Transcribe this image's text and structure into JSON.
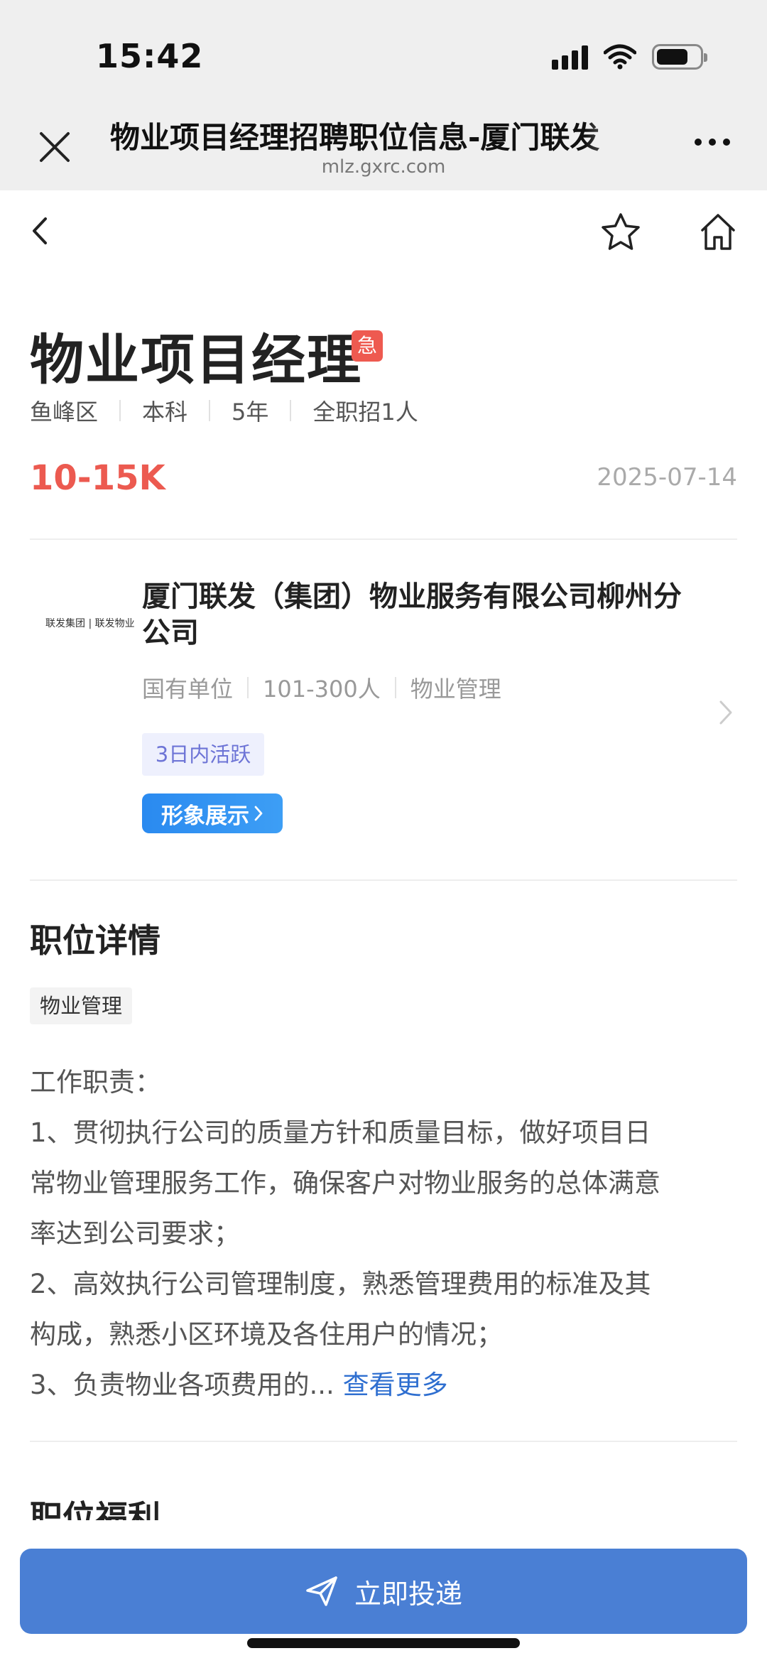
{
  "status_bar": {
    "time": "15:42"
  },
  "browser": {
    "title": "物业项目经理招聘职位信息-厦门联发",
    "url": "mlz.gxrc.com"
  },
  "job": {
    "title": "物业项目经理",
    "urgent": "急",
    "meta": [
      "鱼峰区",
      "本科",
      "5年",
      "全职招1人"
    ],
    "salary": "10-15K",
    "date": "2025-07-14"
  },
  "company": {
    "logo_text": "联发集团 | 联发物业",
    "name": "厦门联发（集团）物业服务有限公司柳州分公司",
    "meta": [
      "国有单位",
      "101-300人",
      "物业管理"
    ],
    "active": "3日内活跃",
    "image_button": "形象展示"
  },
  "details": {
    "section_title": "职位详情",
    "tag": "物业管理",
    "lines": [
      "工作职责：",
      "1、贯彻执行公司的质量方针和质量目标，做好项目日",
      "常物业管理服务工作，确保客户对物业服务的总体满意",
      "率达到公司要求；",
      "2、高效执行公司管理制度，熟悉管理费用的标准及其",
      "构成，熟悉小区环境及各住用户的情况；"
    ],
    "last_line": "3、负责物业各项费用的...",
    "see_more": "查看更多"
  },
  "benefits": {
    "section_title": "职位福利"
  },
  "action": {
    "apply_label": "立即投递"
  },
  "colors": {
    "salary": "#ec5a50",
    "primary": "#4a7fd4",
    "link": "#2f6fd0",
    "urgent": "#ee5a50"
  }
}
